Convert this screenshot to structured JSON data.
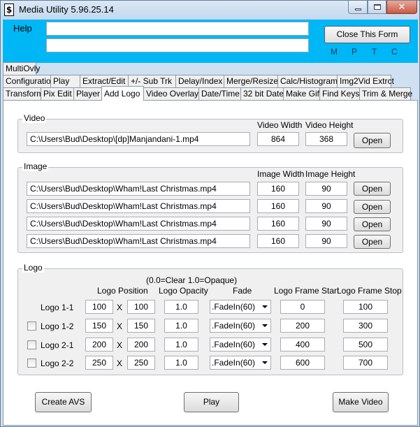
{
  "window": {
    "title": "Media Utility 5.96.25.14",
    "icon_char": "$"
  },
  "menu": {
    "help": "Help"
  },
  "header": {
    "input1_value": "",
    "input2_value": "",
    "close_form": "Close This Form",
    "letters": [
      "M",
      "P",
      "T",
      "C"
    ]
  },
  "tabs_row1": [
    "MultiOvly"
  ],
  "tabs_row2": [
    "Configuration",
    "Play",
    "Extract/Edit",
    "+/- Sub Trk",
    "Delay/Index",
    "Merge/Resize",
    "Calc/Histogram",
    "Img2Vid Extrct"
  ],
  "tabs_row3": [
    "Transform",
    "Pix Edit",
    "Player",
    "Add Logo",
    "Video Overlay",
    "Date/Time",
    "32 bit Date",
    "Make Gif",
    "Find Keys",
    "Trim & Merge"
  ],
  "active_tab": "Add Logo",
  "video": {
    "title": "Video",
    "width_label": "Video Width",
    "height_label": "Video Height",
    "path": "C:\\Users\\Bud\\Desktop\\[dp]Manjandani-1.mp4",
    "width": "864",
    "height": "368",
    "open": "Open"
  },
  "image": {
    "title": "Image",
    "width_label": "Image Width",
    "height_label": "Image Height",
    "rows": [
      {
        "path": "C:\\Users\\Bud\\Desktop\\Wham!Last Christmas.mp4",
        "width": "160",
        "height": "90",
        "open": "Open"
      },
      {
        "path": "C:\\Users\\Bud\\Desktop\\Wham!Last Christmas.mp4",
        "width": "160",
        "height": "90",
        "open": "Open"
      },
      {
        "path": "C:\\Users\\Bud\\Desktop\\Wham!Last Christmas.mp4",
        "width": "160",
        "height": "90",
        "open": "Open"
      },
      {
        "path": "C:\\Users\\Bud\\Desktop\\Wham!Last Christmas.mp4",
        "width": "160",
        "height": "90",
        "open": "Open"
      }
    ]
  },
  "logo": {
    "title": "Logo",
    "opacity_note": "(0.0=Clear  1.0=Opaque)",
    "headers": {
      "position": "Logo Position",
      "opacity": "Logo Opacity",
      "fade": "Fade",
      "frame_start": "Logo Frame Start",
      "frame_stop": "Logo Frame Stop"
    },
    "x_sep": "X",
    "rows": [
      {
        "label": "Logo 1-1",
        "has_checkbox": false,
        "checked": false,
        "pos_x": "100",
        "pos_y": "100",
        "opacity": "1.0",
        "fade": ".FadeIn(60)",
        "start": "0",
        "stop": "100"
      },
      {
        "label": "Logo 1-2",
        "has_checkbox": true,
        "checked": false,
        "pos_x": "150",
        "pos_y": "150",
        "opacity": "1.0",
        "fade": ".FadeIn(60)",
        "start": "200",
        "stop": "300"
      },
      {
        "label": "Logo 2-1",
        "has_checkbox": true,
        "checked": false,
        "pos_x": "200",
        "pos_y": "200",
        "opacity": "1.0",
        "fade": ".FadeIn(60)",
        "start": "400",
        "stop": "500"
      },
      {
        "label": "Logo 2-2",
        "has_checkbox": true,
        "checked": false,
        "pos_x": "250",
        "pos_y": "250",
        "opacity": "1.0",
        "fade": ".FadeIn(60)",
        "start": "600",
        "stop": "700"
      }
    ]
  },
  "actions": {
    "create_avs": "Create AVS",
    "play": "Play",
    "make_video": "Make Video"
  }
}
